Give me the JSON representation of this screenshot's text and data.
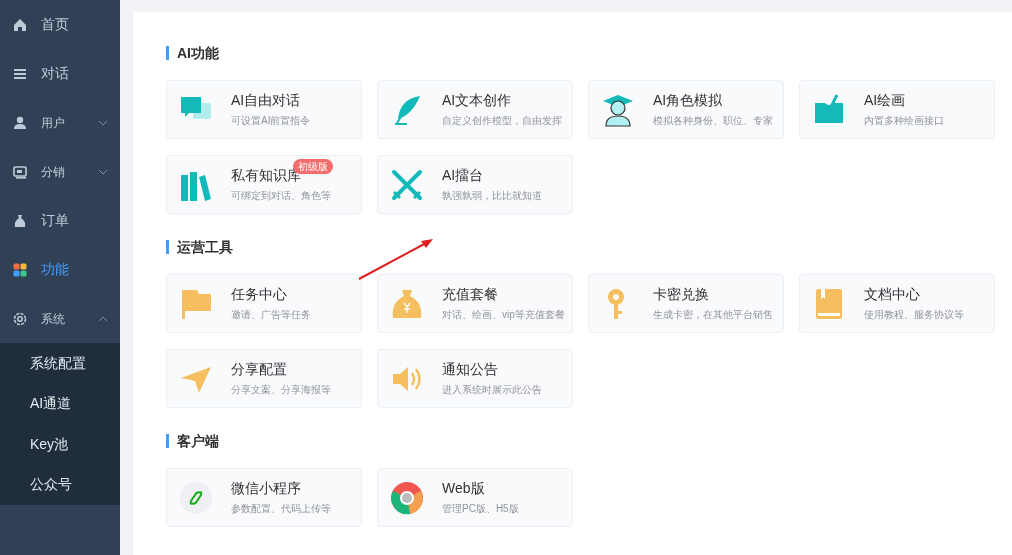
{
  "sidebar": {
    "items": [
      {
        "label": "首页",
        "selected": false
      },
      {
        "label": "对话",
        "selected": false
      },
      {
        "label": "用户",
        "selected": false,
        "expanded": false
      },
      {
        "label": "分销",
        "selected": false,
        "expanded": false
      },
      {
        "label": "订单",
        "selected": false
      },
      {
        "label": "功能",
        "selected": true
      },
      {
        "label": "系统",
        "selected": false,
        "expanded": true,
        "children": [
          {
            "label": "系统配置"
          },
          {
            "label": "AI通道"
          },
          {
            "label": "Key池"
          },
          {
            "label": "公众号"
          }
        ]
      }
    ]
  },
  "sections": [
    {
      "title": "AI功能",
      "cards": [
        {
          "title": "AI自由对话",
          "desc": "可设置AI前置指令"
        },
        {
          "title": "AI文本创作",
          "desc": "自定义创作模型，自由发挥"
        },
        {
          "title": "AI角色模拟",
          "desc": "模拟各种身份、职位、专家"
        },
        {
          "title": "AI绘画",
          "desc": "内置多种绘画接口"
        },
        {
          "title": "私有知识库",
          "desc": "可绑定到对话、角色等",
          "badge": "初级版"
        },
        {
          "title": "AI擂台",
          "desc": "孰强孰弱，比比就知道"
        }
      ]
    },
    {
      "title": "运营工具",
      "cards": [
        {
          "title": "任务中心",
          "desc": "邀请、广告等任务"
        },
        {
          "title": "充值套餐",
          "desc": "对话、绘画、vip等充值套餐"
        },
        {
          "title": "卡密兑换",
          "desc": "生成卡密，在其他平台销售"
        },
        {
          "title": "文档中心",
          "desc": "使用教程、服务协议等"
        },
        {
          "title": "分享配置",
          "desc": "分享文案、分享海报等"
        },
        {
          "title": "通知公告",
          "desc": "进入系统时展示此公告"
        }
      ]
    },
    {
      "title": "客户端",
      "cards": [
        {
          "title": "微信小程序",
          "desc": "参数配置、代码上传等"
        },
        {
          "title": "Web版",
          "desc": "管理PC版、H5版"
        }
      ]
    }
  ]
}
